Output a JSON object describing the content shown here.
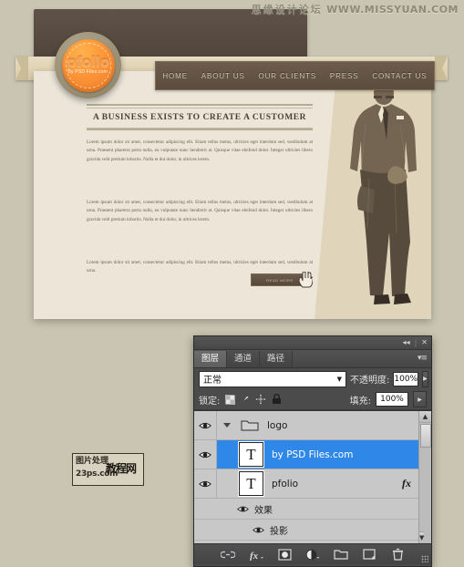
{
  "watermarks": {
    "top_cn": "思缘设计论坛",
    "top_url": "WWW.MISSYUAN.COM",
    "box_line1": "图片处理",
    "box_line2": "23ps.com",
    "box_overlay": "教程网"
  },
  "site": {
    "logo": {
      "word": "pfolio",
      "subtitle": "by PSD Files.com"
    },
    "nav": [
      {
        "label": "HOME"
      },
      {
        "label": "ABOUT US"
      },
      {
        "label": "OUR CLIENTS"
      },
      {
        "label": "PRESS"
      },
      {
        "label": "CONTACT US"
      }
    ],
    "headline": "A BUSINESS EXISTS TO CREATE A CUSTOMER",
    "paragraphs": [
      "Lorem ipsum dolor sit amet, consectetur adipiscing elit. Etiam tellus metus, ultricies eget interdum sed, vestibulum at urna. Praesent pharetra porta nulla, eu vulputate nunc hendrerit at. Quisque vitae eleifend dolor. Integer ultricies libero gravida velit pretium lobortis. Nulla et dui dolor, in ultrices lorem.",
      "Lorem ipsum dolor sit amet, consectetur adipiscing elit. Etiam tellus metus, ultricies eget interdum sed, vestibulum at urna. Praesent pharetra porta nulla, eu vulputate nunc hendrerit at. Quisque vitae eleifend dolor. Integer ultricies libero gravida velit pretium lobortis. Nulla et dui dolor, in ultrices lorem.",
      "Lorem ipsum dolor sit amet, consectetur adipiscing elit. Etiam tellus metus, ultricies eget interdum sed, vestibulum at urna."
    ],
    "read_more_label": "READ MORE"
  },
  "photoshop": {
    "titlebar": {
      "collapse": "◂◂",
      "separator": "|",
      "close": "✕"
    },
    "tabs": [
      {
        "label": "图层",
        "active": true
      },
      {
        "label": "通道",
        "active": false
      },
      {
        "label": "路径",
        "active": false
      }
    ],
    "panel_menu": "▾≡",
    "blend_mode": {
      "value": "正常",
      "caret": "▼"
    },
    "opacity": {
      "label": "不透明度:",
      "value": "100%",
      "spinner": "▶"
    },
    "lock": {
      "label": "锁定:",
      "icons": [
        "transparency-lock-icon",
        "brush-lock-icon",
        "move-lock-icon",
        "all-lock-icon"
      ]
    },
    "fill": {
      "label": "填充:",
      "value": "100%",
      "spinner": "▶"
    },
    "layers": [
      {
        "name": "logo",
        "type": "group",
        "thumb": "folder",
        "selected": false,
        "has_fx": false,
        "expanded": true
      },
      {
        "name": "by PSD Files.com",
        "type": "text",
        "thumb": "T",
        "selected": true,
        "has_fx": false
      },
      {
        "name": "pfolio",
        "type": "text",
        "thumb": "T",
        "selected": false,
        "has_fx": true,
        "fx_label": "fx"
      }
    ],
    "effects": [
      {
        "name": "效果",
        "level": 1
      },
      {
        "name": "投影",
        "level": 2
      }
    ],
    "footer_icons": [
      "link-layers-icon",
      "add-layer-style-icon",
      "add-layer-mask-icon",
      "new-adjustment-layer-icon",
      "new-group-icon",
      "new-layer-icon",
      "delete-layer-icon"
    ]
  }
}
